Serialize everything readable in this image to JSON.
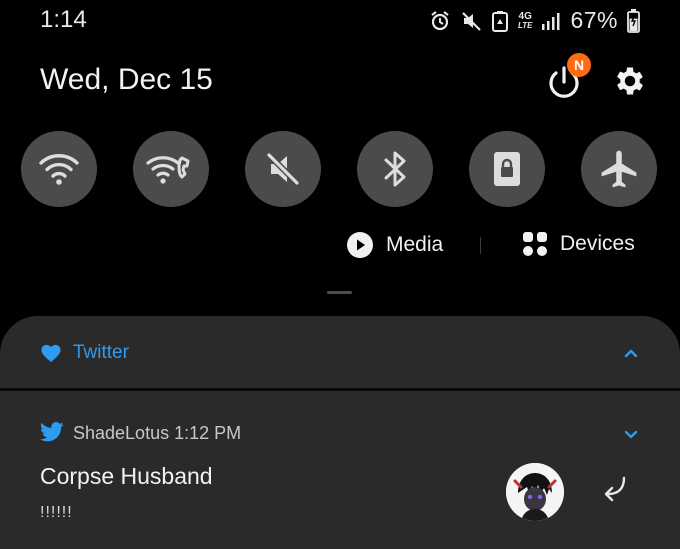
{
  "status_bar": {
    "time": "1:14",
    "icons": [
      "alarm-icon",
      "mute-icon",
      "recycle-icon",
      "4g-lte-icon",
      "signal-icon"
    ],
    "network": "4G",
    "network_sub": "LTE",
    "battery_percent": "67%",
    "battery_level": 0.67
  },
  "header": {
    "date": "Wed, Dec 15",
    "power_badge": "N"
  },
  "quick_tiles": [
    "wifi-icon",
    "wifi-calling-icon",
    "mute-icon",
    "bluetooth-icon",
    "screen-lock-icon",
    "airplane-mode-icon"
  ],
  "controls": {
    "media_label": "Media",
    "devices_label": "Devices"
  },
  "notification_group": {
    "app_name": "Twitter",
    "accent_color": "#2d9bf0",
    "notification": {
      "meta": "ShadeLotus 1:12 PM",
      "title": "Corpse Husband",
      "body": "!!!!!!"
    }
  },
  "colors": {
    "background": "#000000",
    "panel": "#2a2a2a",
    "tile": "#4b4b4b",
    "badge": "#ff6a14",
    "twitter_blue": "#2d9bf0"
  }
}
